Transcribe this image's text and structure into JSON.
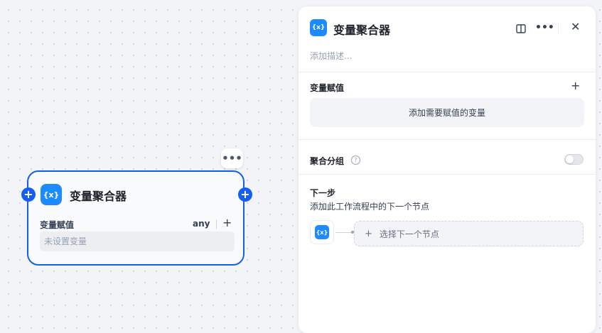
{
  "canvas": {
    "more_label": "•••",
    "node": {
      "title": "变量聚合器",
      "icon_text": "{x}",
      "variable_label": "变量赋值",
      "type_label": "any",
      "add_label": "+",
      "empty_text": "未设置变量",
      "handle_label": "+"
    }
  },
  "panel": {
    "icon_text": "{x}",
    "title": "变量聚合器",
    "more_label": "•••",
    "close_label": "✕",
    "description_placeholder": "添加描述...",
    "assignment": {
      "label": "变量赋值",
      "add_label": "+",
      "add_button_label": "添加需要赋值的变量"
    },
    "group": {
      "label": "聚合分组",
      "help_label": "?",
      "enabled": false
    },
    "next_step": {
      "label": "下一步",
      "description": "添加此工作流程中的下一个节点",
      "from_icon_text": "{x}",
      "plus_label": "+",
      "select_label": "选择下一个节点"
    }
  },
  "colors": {
    "accent": "#155eef",
    "node_icon": "#1c8bff"
  }
}
